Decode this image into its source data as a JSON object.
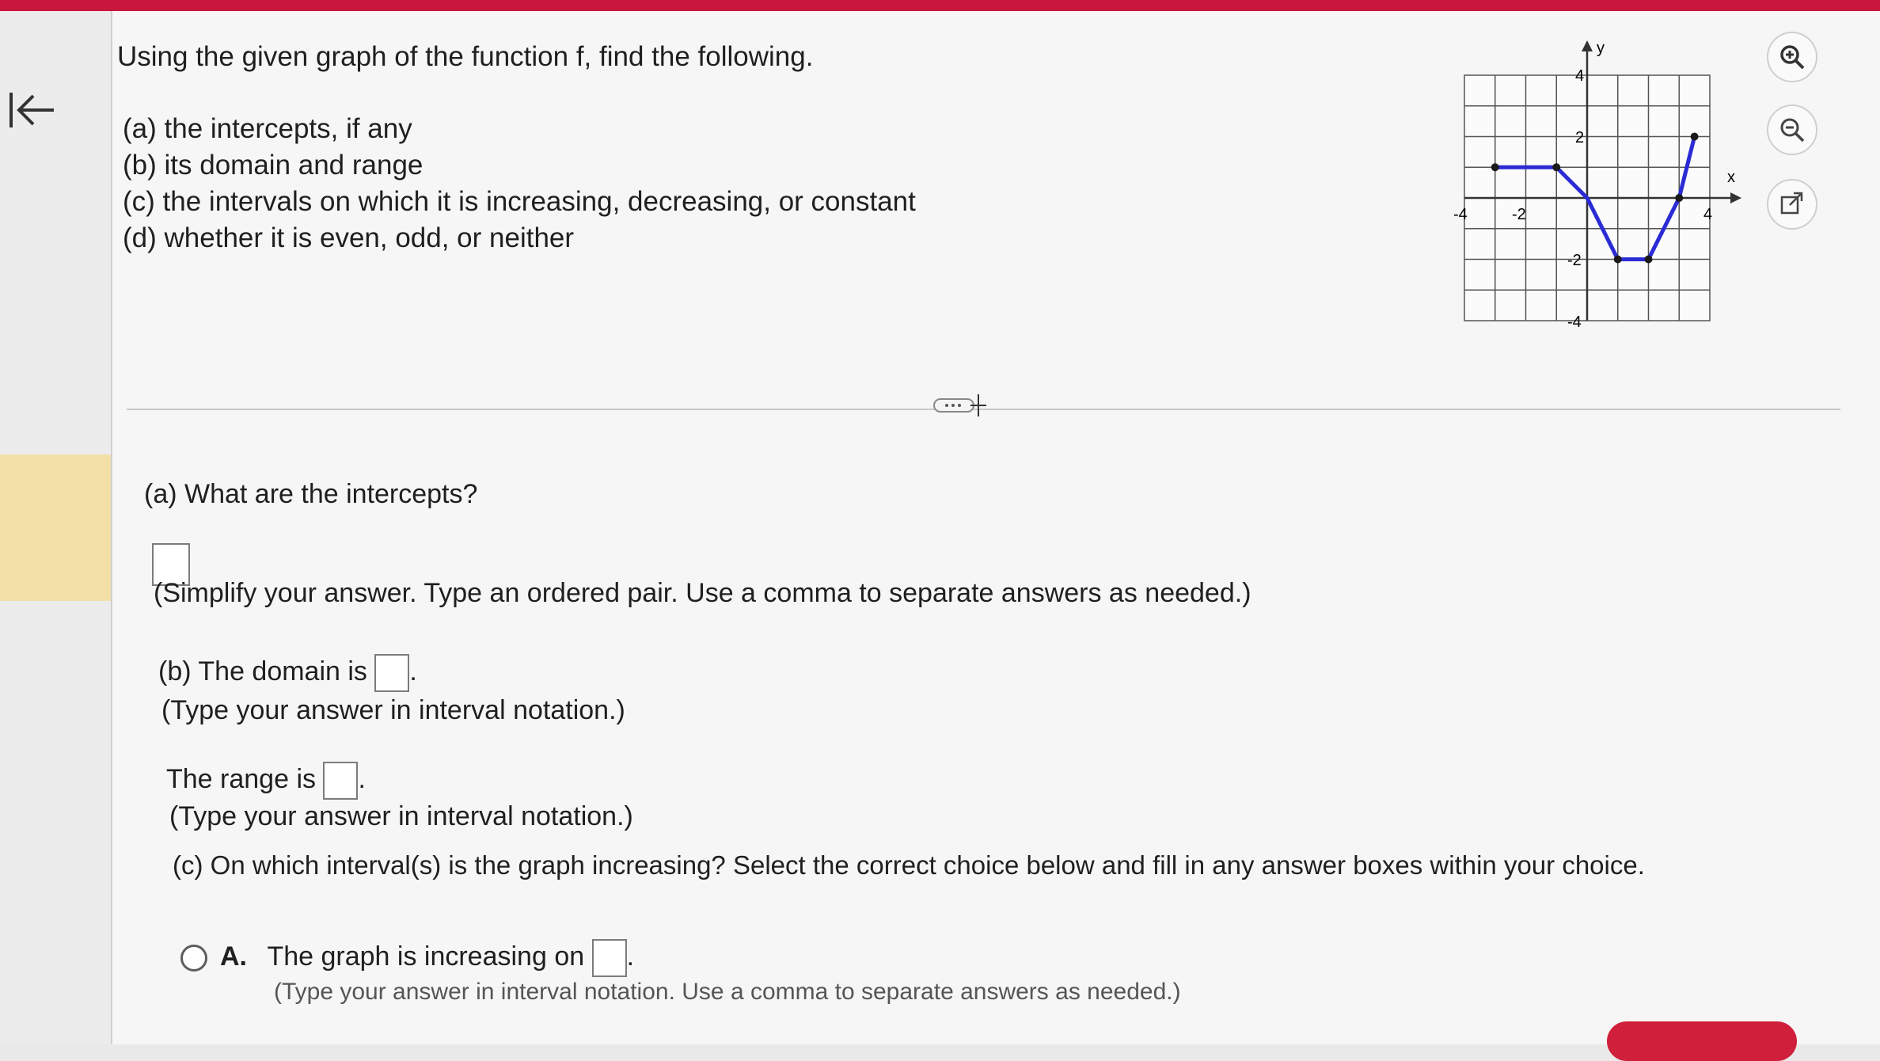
{
  "question": {
    "prompt": "Using the given graph of the function f, find the following.",
    "parts": [
      {
        "letter": "(a)",
        "text": "the intercepts, if any"
      },
      {
        "letter": "(b)",
        "text": "its domain and range"
      },
      {
        "letter": "(c)",
        "text": "the intervals on which it is increasing, decreasing, or constant"
      },
      {
        "letter": "(d)",
        "text": "whether it is even, odd, or neither"
      }
    ]
  },
  "graph": {
    "x_label": "x",
    "y_label": "y",
    "tick_labels": {
      "x_neg4": "-4",
      "x_neg2": "-2",
      "x_pos4": "4",
      "y_pos4": "4",
      "y_pos2": "2",
      "y_neg2": "-2",
      "y_neg4": "-4"
    },
    "line_color": "#2b2bd6",
    "points": [
      [
        -3,
        1
      ],
      [
        -1,
        1
      ],
      [
        0,
        0
      ],
      [
        1,
        -2
      ],
      [
        2,
        -2
      ],
      [
        3,
        0
      ],
      [
        3.5,
        2
      ]
    ]
  },
  "tools": {
    "zoom_in": "zoom-in-icon",
    "zoom_out": "zoom-out-icon",
    "popout": "external-link-icon"
  },
  "answers": {
    "a_question": "(a) What are the intercepts?",
    "a_hint": "(Simplify your answer. Type an ordered pair. Use a comma to separate answers as needed.)",
    "b_domain_prefix": "(b) The domain is",
    "b_domain_hint": "(Type your answer in interval notation.)",
    "b_range_prefix": "The range is",
    "b_range_hint": "(Type your answer in interval notation.)",
    "c_question": "(c) On which interval(s) is the graph increasing? Select the correct choice below and fill in any answer boxes within your choice.",
    "choice_a_letter": "A.",
    "choice_a_text": "The graph is increasing on",
    "choice_a_hint": "(Type your answer in interval notation. Use a comma to separate answers as needed.)"
  },
  "colors": {
    "accent_red": "#c8173f",
    "highlight_yellow": "#f3e0a8"
  }
}
